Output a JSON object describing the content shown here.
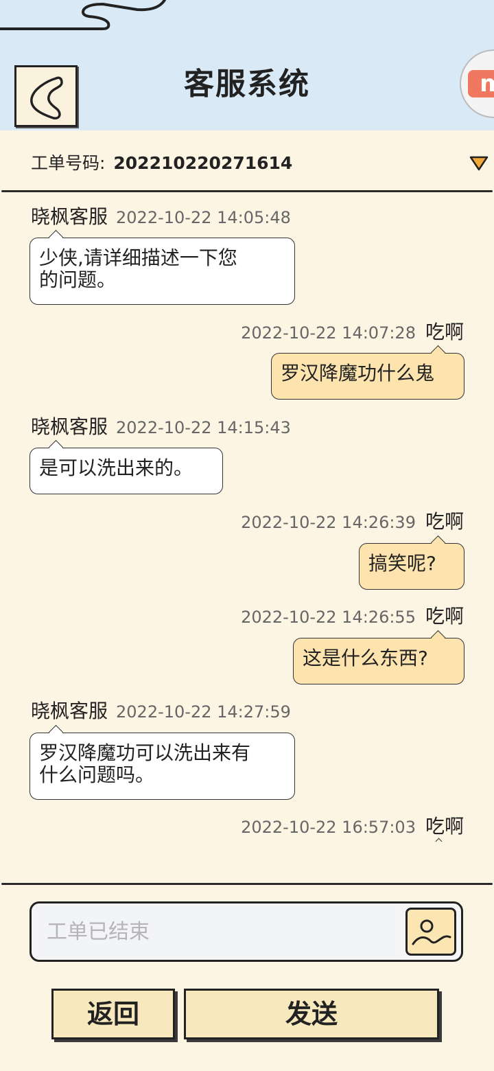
{
  "header": {
    "title": "客服系统",
    "colors": {
      "background": "#d9e9f5",
      "page_background": "#fdf5e4"
    },
    "icons": {
      "back": "chevron-left-icon",
      "logo": "app-logo-icon"
    }
  },
  "ticket": {
    "label": "工单号码:",
    "number": "202210220271614",
    "dropdown_icon": "triangle-down-icon",
    "dropdown_color": "#f3a93a"
  },
  "messages": [
    {
      "side": "left",
      "sender": "晓枫客服",
      "time": "2022-10-22 14:05:48",
      "lines": [
        "少侠,请详细描述一下您",
        "的问题。"
      ]
    },
    {
      "side": "right",
      "sender": "吃啊",
      "time": "2022-10-22 14:07:28",
      "lines": [
        "罗汉降魔功什么鬼"
      ]
    },
    {
      "side": "left",
      "sender": "晓枫客服",
      "time": "2022-10-22 14:15:43",
      "lines": [
        "是可以洗出来的。"
      ]
    },
    {
      "side": "right",
      "sender": "吃啊",
      "time": "2022-10-22 14:26:39",
      "lines": [
        "搞笑呢?"
      ]
    },
    {
      "side": "right",
      "sender": "吃啊",
      "time": "2022-10-22 14:26:55",
      "lines": [
        "这是什么东西?"
      ]
    },
    {
      "side": "left",
      "sender": "晓枫客服",
      "time": "2022-10-22 14:27:59",
      "lines": [
        "罗汉降魔功可以洗出来有",
        "什么问题吗。"
      ]
    },
    {
      "side": "right",
      "sender": "吃啊",
      "time": "2022-10-22 16:57:03"
    }
  ],
  "input": {
    "placeholder": "工单已结束",
    "value": "",
    "image_icon": "image-icon"
  },
  "buttons": {
    "back_label": "返回",
    "send_label": "发送"
  },
  "bubble_colors": {
    "left": "#ffffff",
    "right": "#fde3ae"
  }
}
